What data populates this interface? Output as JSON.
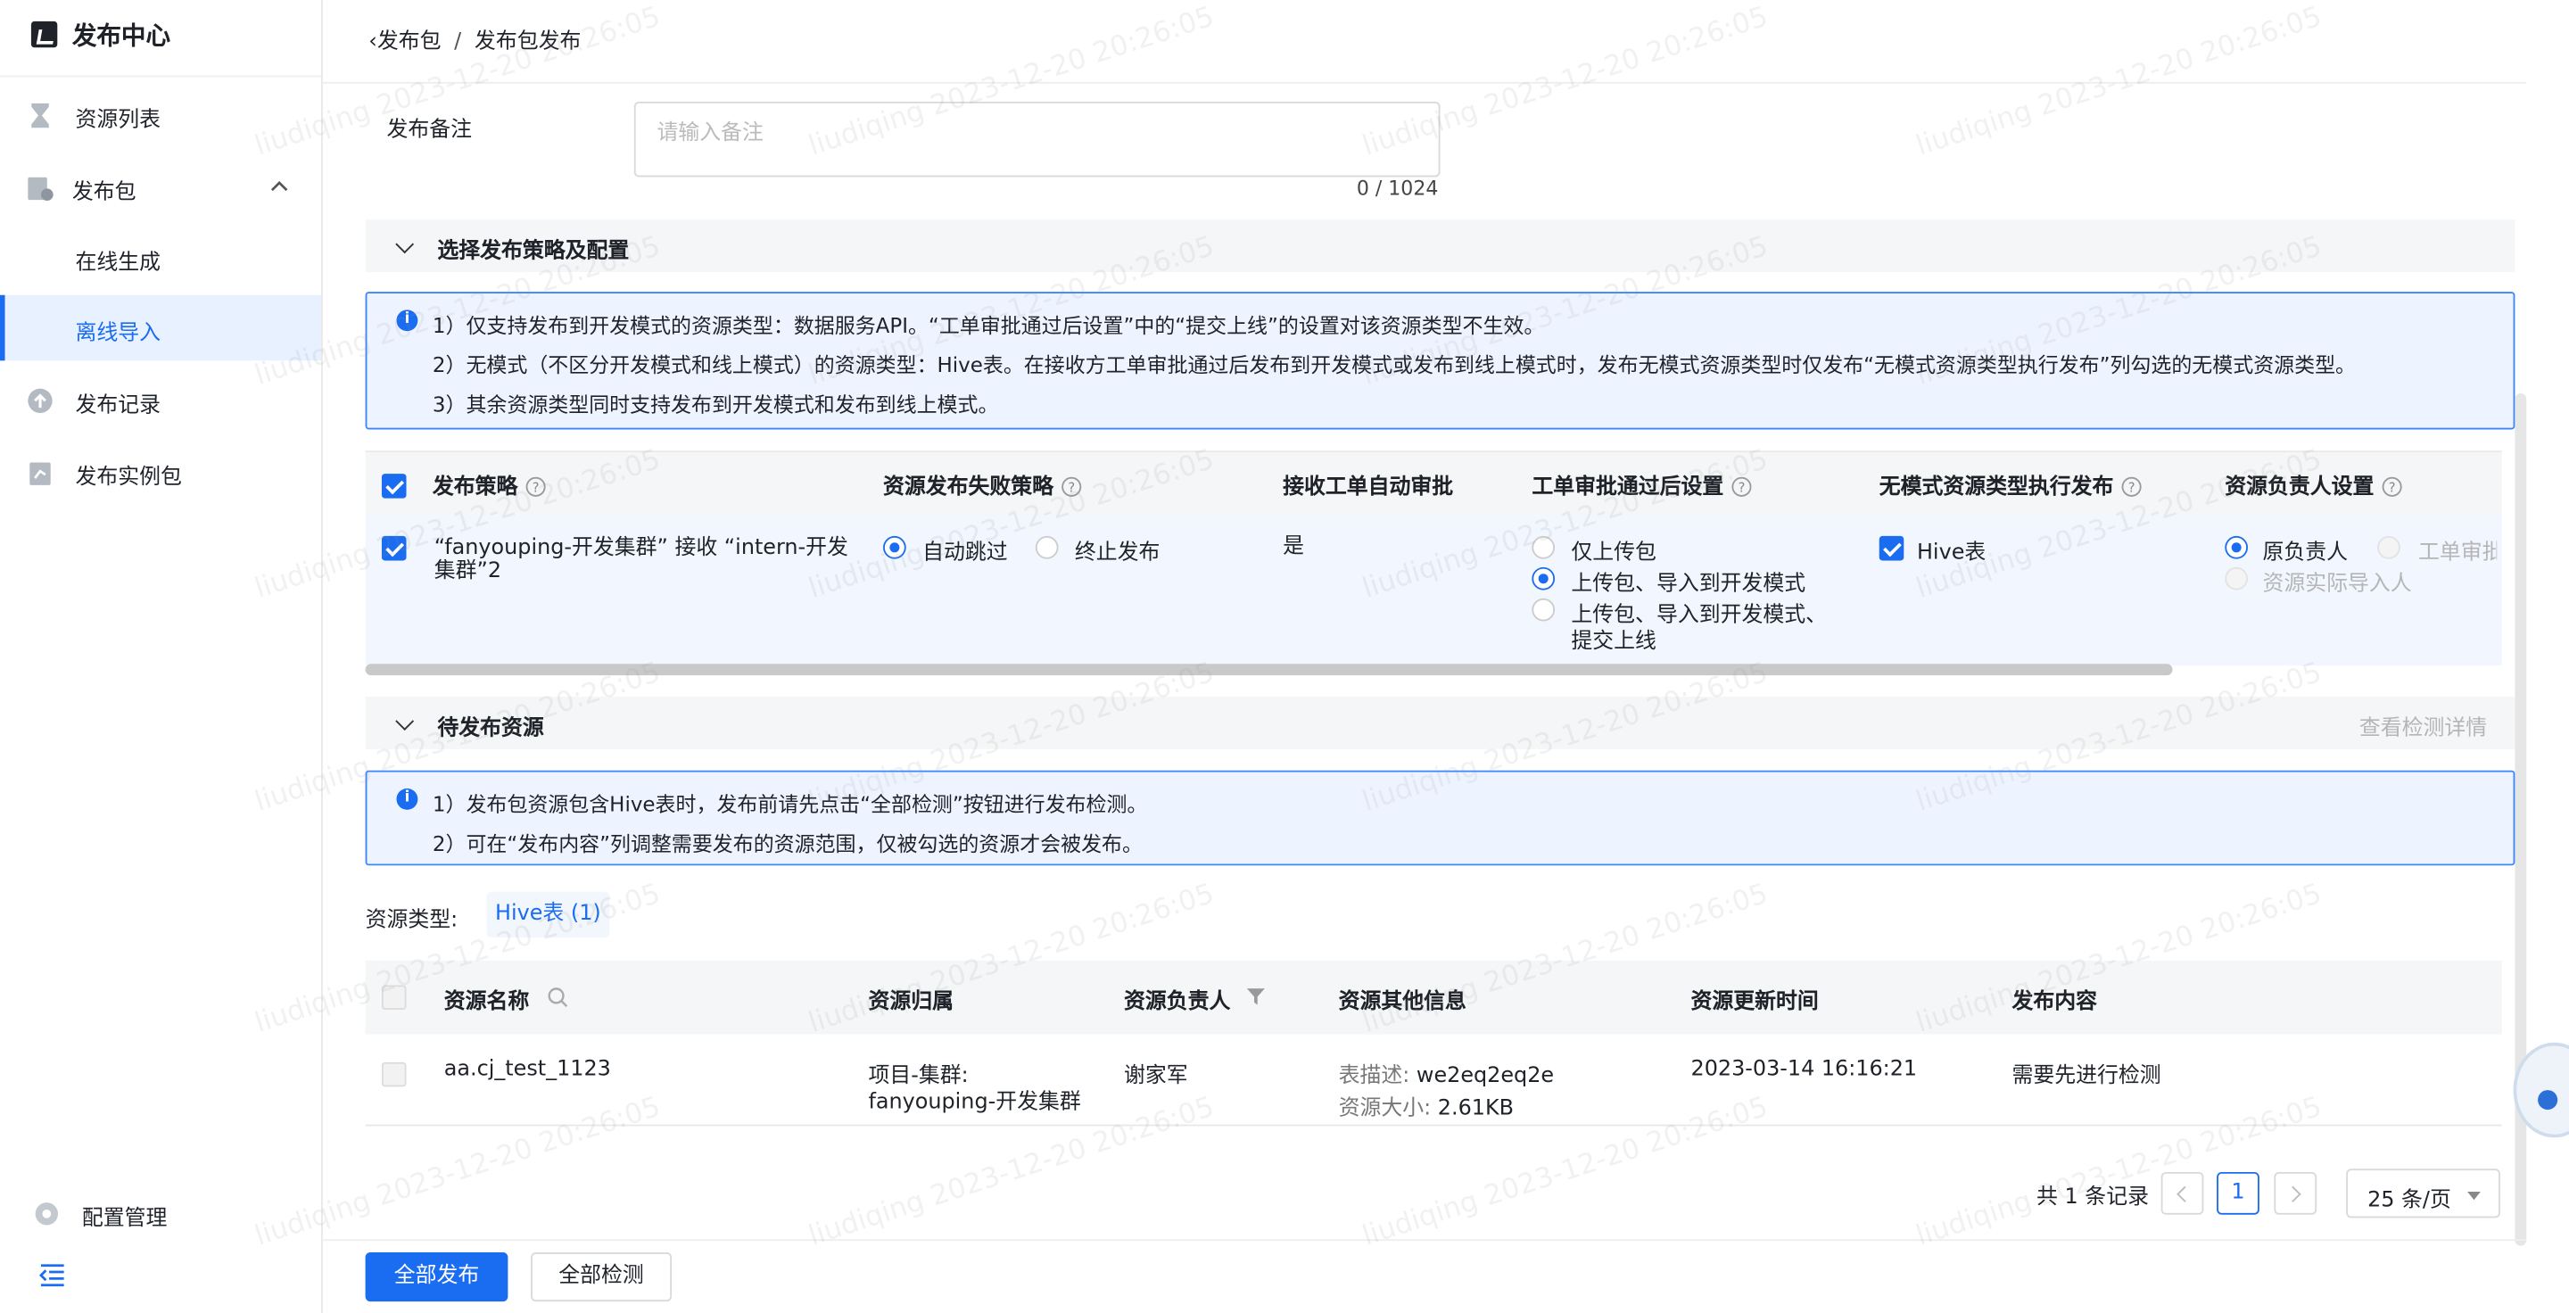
{
  "app": {
    "title": "发布中心"
  },
  "sidebar": {
    "items": [
      {
        "label": "资源列表",
        "icon": "hourglass-icon"
      },
      {
        "label": "发布包",
        "icon": "package-icon"
      },
      {
        "label": "在线生成"
      },
      {
        "label": "离线导入"
      },
      {
        "label": "发布记录",
        "icon": "upload-cloud-icon"
      },
      {
        "label": "发布实例包",
        "icon": "instance-package-icon"
      }
    ],
    "config_label": "配置管理"
  },
  "breadcrumb": {
    "back": "发布包",
    "separator": "/",
    "current": "发布包发布"
  },
  "remark": {
    "label": "发布备注",
    "placeholder": "请输入备注",
    "counter": "0 / 1024"
  },
  "strategy_section": {
    "title": "选择发布策略及配置",
    "info": [
      "1）仅支持发布到开发模式的资源类型：数据服务API。“工单审批通过后设置”中的“提交上线”的设置对该资源类型不生效。",
      "2）无模式（不区分开发模式和线上模式）的资源类型：Hive表。在接收方工单审批通过后发布到开发模式或发布到线上模式时，发布无模式资源类型时仅发布“无模式资源类型执行发布”列勾选的无模式资源类型。",
      "3）其余资源类型同时支持发布到开发模式和发布到线上模式。"
    ],
    "columns": [
      "发布策略",
      "资源发布失败策略",
      "接收工单自动审批",
      "工单审批通过后设置",
      "无模式资源类型执行发布",
      "资源负责人设置"
    ],
    "row": {
      "strategy_line1": "“fanyouping-开发集群” 接收 “intern-开发",
      "strategy_line2": "集群”2",
      "fail_options": [
        "自动跳过",
        "终止发布"
      ],
      "auto_approve": "是",
      "after_options": [
        "仅上传包",
        "上传包、导入到开发模式",
        "上传包、导入到开发模式、",
        "提交上线"
      ],
      "schemaless": "Hive表",
      "owner_options": [
        "原负责人",
        "工单审批",
        "资源实际导入人"
      ]
    }
  },
  "pending_section": {
    "title": "待发布资源",
    "detail_link": "查看检测详情",
    "info": [
      "1）发布包资源包含Hive表时，发布前请先点击“全部检测”按钮进行发布检测。",
      "2）可在“发布内容”列调整需要发布的资源范围，仅被勾选的资源才会被发布。"
    ],
    "type_label": "资源类型:",
    "type_tag": "Hive表 (1)",
    "columns": [
      "资源名称",
      "资源归属",
      "资源负责人",
      "资源其他信息",
      "资源更新时间",
      "发布内容"
    ],
    "rows": [
      {
        "name": "aa.cj_test_1123",
        "owner_scope_line1": "项目-集群:",
        "owner_scope_line2": "fanyouping-开发集群",
        "owner": "谢家军",
        "desc_label": "表描述:",
        "desc_value": "we2eq2eq2e",
        "size_label": "资源大小:",
        "size_value": "2.61KB",
        "updated": "2023-03-14 16:16:21",
        "content": "需要先进行检测"
      }
    ]
  },
  "pagination": {
    "total": "共 1 条记录",
    "current": "1",
    "page_size": "25 条/页"
  },
  "actions": {
    "publish_all": "全部发布",
    "check_all": "全部检测"
  },
  "watermark": "liudiqing 2023-12-20 20:26:05",
  "colors": {
    "primary": "#1a6cf0",
    "info_border": "#3a86ff",
    "info_bg": "#eef4ff"
  }
}
